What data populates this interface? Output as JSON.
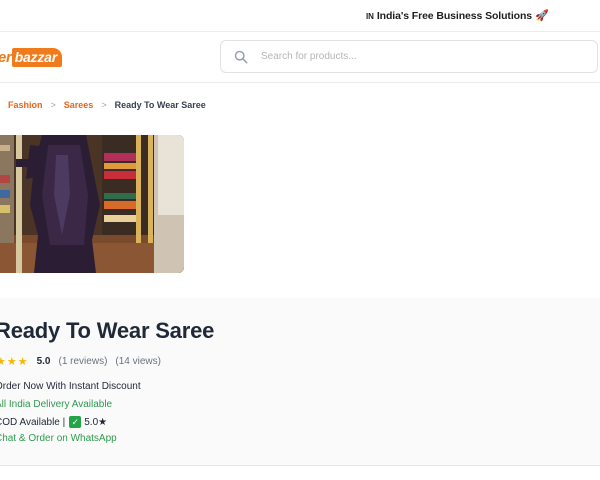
{
  "topbar": {
    "flag_code": "IN",
    "text": "India's Free Business Solutions",
    "emoji": "🚀"
  },
  "header": {
    "logo_part1": "er",
    "logo_part2": "bazzar",
    "search_placeholder": "Search for products..."
  },
  "breadcrumb": {
    "items": [
      "Fashion",
      "Sarees"
    ],
    "current": "Ready To Wear Saree",
    "separator": ">"
  },
  "product": {
    "title": "Ready To Wear Saree",
    "stars": "★★★",
    "rating": "5.0",
    "reviews": "(1 reviews)",
    "views": "(14 views)",
    "line1": "Order Now With Instant Discount",
    "line2": "All India Delivery Available",
    "line3_prefix": "COD Available |",
    "line3_check": "✓",
    "line3_rating": "5.0★",
    "line4": "Chat & Order on WhatsApp"
  },
  "colors": {
    "accent": "#f07b1d",
    "link": "#e8641c",
    "success": "#2e9b4f",
    "star": "#f5b800"
  }
}
